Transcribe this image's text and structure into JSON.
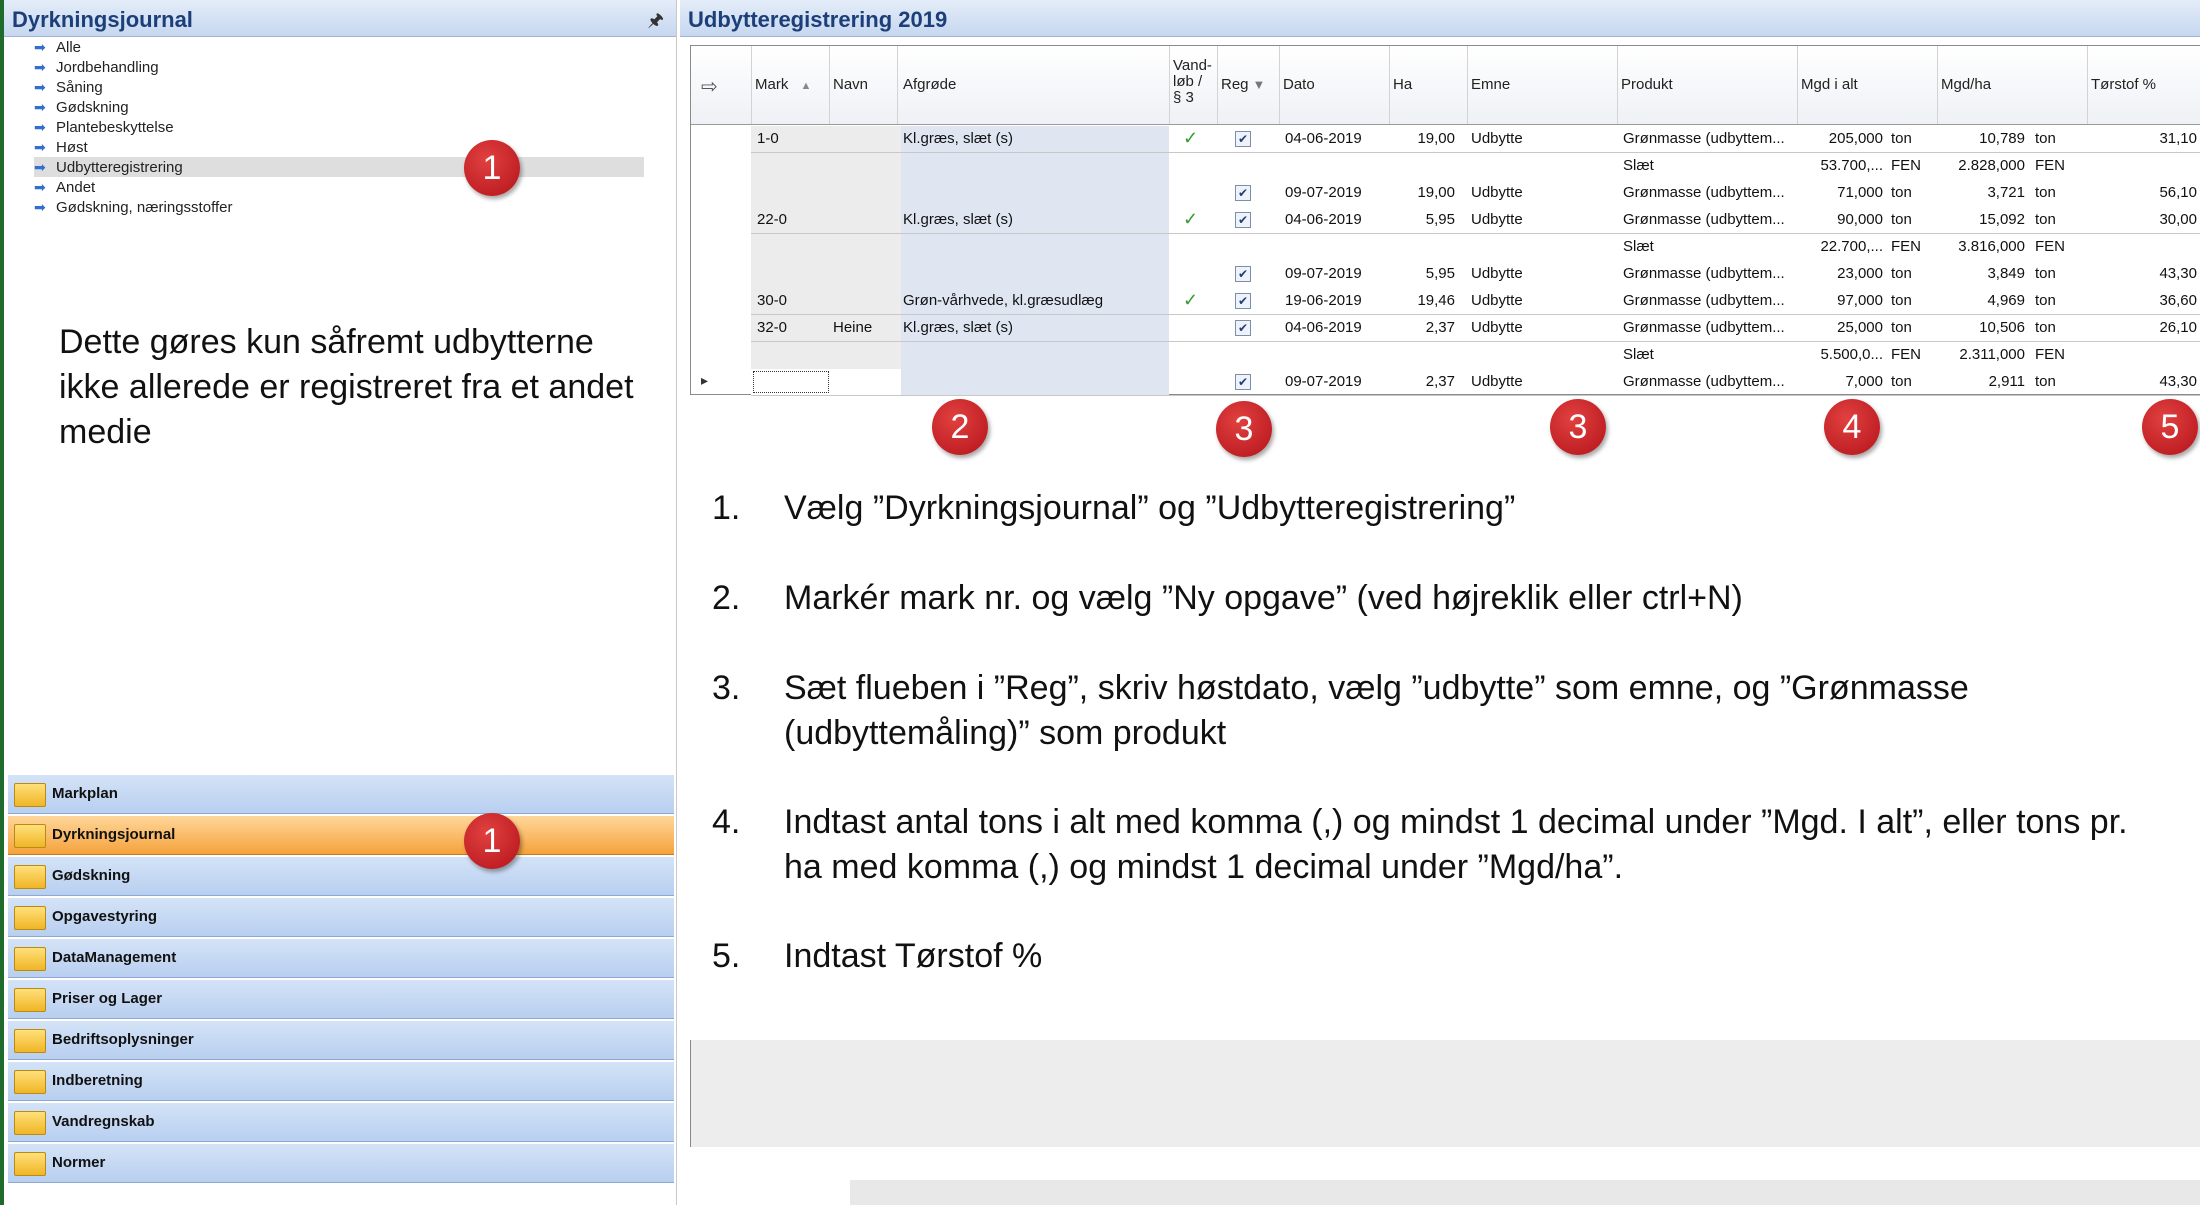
{
  "left_panel": {
    "title": "Dyrkningsjournal",
    "pin_icon": "pin-icon",
    "tree": [
      {
        "label": "Alle",
        "selected": false
      },
      {
        "label": "Jordbehandling",
        "selected": false
      },
      {
        "label": "Såning",
        "selected": false
      },
      {
        "label": "Gødskning",
        "selected": false
      },
      {
        "label": "Plantebeskyttelse",
        "selected": false
      },
      {
        "label": "Høst",
        "selected": false
      },
      {
        "label": "Udbytteregistrering",
        "selected": true
      },
      {
        "label": "Andet",
        "selected": false
      },
      {
        "label": "Gødskning, næringsstoffer",
        "selected": false
      }
    ],
    "note": "Dette gøres kun såfremt udbytterne ikke allerede er registreret fra et andet medie"
  },
  "nav": [
    {
      "label": "Markplan",
      "active": false
    },
    {
      "label": "Dyrkningsjournal",
      "active": true
    },
    {
      "label": "Gødskning",
      "active": false
    },
    {
      "label": "Opgavestyring",
      "active": false
    },
    {
      "label": "DataManagement",
      "active": false
    },
    {
      "label": "Priser og Lager",
      "active": false
    },
    {
      "label": "Bedriftsoplysninger",
      "active": false
    },
    {
      "label": "Indberetning",
      "active": false
    },
    {
      "label": "Vandregnskab",
      "active": false
    },
    {
      "label": "Normer",
      "active": false
    }
  ],
  "right_panel": {
    "title": "Udbytteregistrering 2019"
  },
  "grid": {
    "columns": [
      "Mark",
      "Navn",
      "Afgrøde",
      "Vand-\nløb /\n§ 3",
      "Reg",
      "Dato",
      "Ha",
      "Emne",
      "Produkt",
      "Mgd i alt",
      "Mgd/ha",
      "Tørstof %"
    ],
    "sort_icon": "sort-asc-icon",
    "filter_icon": "filter-icon",
    "rows": [
      {
        "mark": "1-0",
        "navn": "",
        "afgrode": "Kl.græs,  slæt (s)",
        "vandlob": "✓",
        "reg": true,
        "dato": "04-06-2019",
        "ha": "19,00",
        "emne": "Udbytte",
        "produkt": "Grønmasse (udbyttem...",
        "mgd_alt": "205,000",
        "unit1": "ton",
        "mgd_ha": "10,789",
        "unit2": "ton",
        "torstof": "31,10"
      },
      {
        "mark": "",
        "navn": "",
        "afgrode": "",
        "vandlob": "",
        "reg": null,
        "dato": "",
        "ha": "",
        "emne": "",
        "produkt": "Slæt",
        "mgd_alt": "53.700,...",
        "unit1": "FEN",
        "mgd_ha": "2.828,000",
        "unit2": "FEN",
        "torstof": ""
      },
      {
        "mark": "",
        "navn": "",
        "afgrode": "",
        "vandlob": "",
        "reg": true,
        "dato": "09-07-2019",
        "ha": "19,00",
        "emne": "Udbytte",
        "produkt": "Grønmasse (udbyttem...",
        "mgd_alt": "71,000",
        "unit1": "ton",
        "mgd_ha": "3,721",
        "unit2": "ton",
        "torstof": "56,10"
      },
      {
        "mark": "22-0",
        "navn": "",
        "afgrode": "Kl.græs,  slæt (s)",
        "vandlob": "✓",
        "reg": true,
        "dato": "04-06-2019",
        "ha": "5,95",
        "emne": "Udbytte",
        "produkt": "Grønmasse (udbyttem...",
        "mgd_alt": "90,000",
        "unit1": "ton",
        "mgd_ha": "15,092",
        "unit2": "ton",
        "torstof": "30,00"
      },
      {
        "mark": "",
        "navn": "",
        "afgrode": "",
        "vandlob": "",
        "reg": null,
        "dato": "",
        "ha": "",
        "emne": "",
        "produkt": "Slæt",
        "mgd_alt": "22.700,...",
        "unit1": "FEN",
        "mgd_ha": "3.816,000",
        "unit2": "FEN",
        "torstof": ""
      },
      {
        "mark": "",
        "navn": "",
        "afgrode": "",
        "vandlob": "",
        "reg": true,
        "dato": "09-07-2019",
        "ha": "5,95",
        "emne": "Udbytte",
        "produkt": "Grønmasse (udbyttem...",
        "mgd_alt": "23,000",
        "unit1": "ton",
        "mgd_ha": "3,849",
        "unit2": "ton",
        "torstof": "43,30"
      },
      {
        "mark": "30-0",
        "navn": "",
        "afgrode": "Grøn-vårhvede, kl.græsudlæg",
        "vandlob": "✓",
        "reg": true,
        "dato": "19-06-2019",
        "ha": "19,46",
        "emne": "Udbytte",
        "produkt": "Grønmasse (udbyttem...",
        "mgd_alt": "97,000",
        "unit1": "ton",
        "mgd_ha": "4,969",
        "unit2": "ton",
        "torstof": "36,60"
      },
      {
        "mark": "32-0",
        "navn": "Heine",
        "afgrode": "Kl.græs,  slæt (s)",
        "vandlob": "",
        "reg": true,
        "dato": "04-06-2019",
        "ha": "2,37",
        "emne": "Udbytte",
        "produkt": "Grønmasse (udbyttem...",
        "mgd_alt": "25,000",
        "unit1": "ton",
        "mgd_ha": "10,506",
        "unit2": "ton",
        "torstof": "26,10"
      },
      {
        "mark": "",
        "navn": "",
        "afgrode": "",
        "vandlob": "",
        "reg": null,
        "dato": "",
        "ha": "",
        "emne": "",
        "produkt": "Slæt",
        "mgd_alt": "5.500,0...",
        "unit1": "FEN",
        "mgd_ha": "2.311,000",
        "unit2": "FEN",
        "torstof": ""
      },
      {
        "mark": "",
        "navn": "",
        "afgrode": "",
        "vandlob": "",
        "reg": true,
        "dato": "09-07-2019",
        "ha": "2,37",
        "emne": "Udbytte",
        "produkt": "Grønmasse (udbyttem...",
        "mgd_alt": "7,000",
        "unit1": "ton",
        "mgd_ha": "2,911",
        "unit2": "ton",
        "torstof": "43,30"
      }
    ]
  },
  "badges": [
    "1",
    "1",
    "2",
    "3",
    "3",
    "4",
    "5"
  ],
  "instructions": [
    {
      "n": "1.",
      "text": "Vælg ”Dyrkningsjournal” og ”Udbytteregistrering”"
    },
    {
      "n": "2.",
      "text": "Markér mark nr. og vælg ”Ny opgave” (ved højreklik eller ctrl+N)"
    },
    {
      "n": "3.",
      "text": "Sæt flueben i ”Reg”, skriv høstdato, vælg ”udbytte” som emne, og ”Grønmasse (udbyttemåling)” som produkt"
    },
    {
      "n": "4.",
      "text": "Indtast antal tons i alt med komma (,) og mindst 1 decimal under ”Mgd. I alt”, eller tons pr. ha med komma (,) og mindst 1 decimal under ”Mgd/ha”."
    },
    {
      "n": "5.",
      "text": "Indtast Tørstof %"
    }
  ],
  "colors": {
    "accent_title": "#1c3f7a",
    "active_nav": "#f5a23c",
    "badge": "#c8161d",
    "check_green": "#3a9a35"
  }
}
